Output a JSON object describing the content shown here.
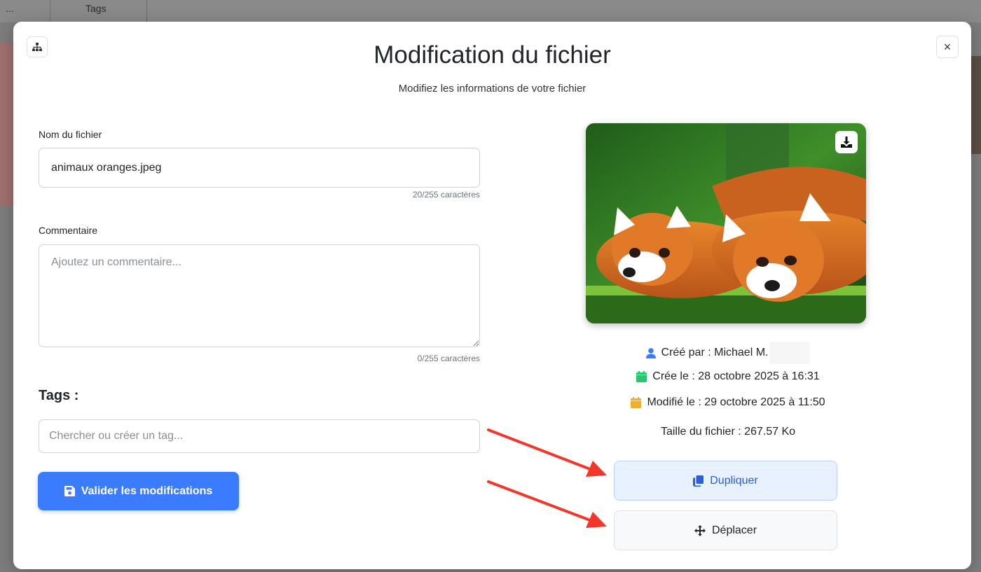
{
  "background": {
    "tab_fragment_left": "...",
    "tab_label": "Tags"
  },
  "modal": {
    "title": "Modification du fichier",
    "subtitle": "Modifiez les informations de votre fichier",
    "close_label": "×"
  },
  "form": {
    "filename_label": "Nom du fichier",
    "filename_value": "animaux oranges.jpeg",
    "filename_counter": "20/255 caractères",
    "comment_label": "Commentaire",
    "comment_placeholder": "Ajoutez un commentaire...",
    "comment_value": "",
    "comment_counter": "0/255 caractères",
    "tags_heading": "Tags :",
    "tag_placeholder": "Chercher ou créer un tag...",
    "submit_label": "Valider les modifications"
  },
  "file_info": {
    "created_by": "Créé par : Michael M.",
    "created_on": "Crée le : 28 octobre 2025 à 16:31",
    "modified_on": "Modifié le : 29 octobre 2025 à 11:50",
    "size": "Taille du fichier : 267.57 Ko"
  },
  "actions": {
    "duplicate_label": "Dupliquer",
    "move_label": "Déplacer"
  },
  "colors": {
    "primary": "#3b7cff",
    "user_icon": "#3b7cff",
    "created_icon": "#28c76f",
    "modified_icon": "#f0ad2e",
    "annotation_arrow": "#f2372a"
  },
  "icons": {
    "top_left": "sitemap-icon",
    "close": "close-icon",
    "download": "download-icon",
    "save": "floppy-disk-icon",
    "user": "user-icon",
    "calendar": "calendar-icon",
    "duplicate": "copy-icon",
    "move": "arrows-move-icon"
  }
}
